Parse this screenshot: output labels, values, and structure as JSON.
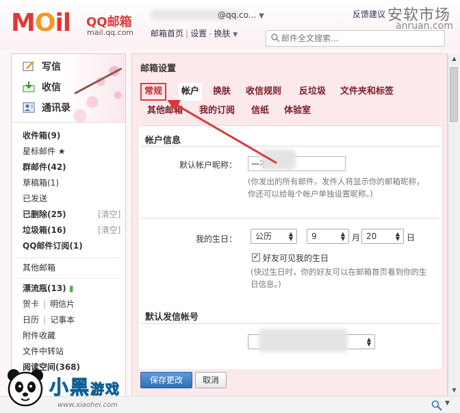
{
  "header": {
    "logo_text": "MOil",
    "logo_cn": "QQ邮箱",
    "logo_url": "mail.qq.com",
    "email_suffix": "@qq.co...",
    "nav": [
      "邮箱首页",
      "设置",
      "换肤"
    ],
    "feedback": "反馈建议",
    "watermark_cn": "安软市场",
    "watermark_url": "anruan.com",
    "search_placeholder": "邮件全文搜索..."
  },
  "sidebar": {
    "quick_actions": [
      {
        "label": "写信",
        "icon": "compose-icon"
      },
      {
        "label": "收信",
        "icon": "inbox-download-icon"
      },
      {
        "label": "通讯录",
        "icon": "contacts-icon"
      }
    ],
    "folders": [
      {
        "label": "收件箱(9)",
        "bold": true
      },
      {
        "label": "星标邮件 ★",
        "bold": false
      },
      {
        "label": "群邮件(42)",
        "bold": true
      },
      {
        "label": "草稿箱(1)",
        "bold": false
      },
      {
        "label": "已发送",
        "bold": false
      },
      {
        "label": "已删除(25)",
        "bold": true,
        "clear": "[清空]"
      },
      {
        "label": "垃圾箱(16)",
        "bold": true,
        "clear": "[清空]"
      },
      {
        "label": "QQ邮件订阅(1)",
        "bold": true
      }
    ],
    "other_mailbox": "其他邮箱",
    "extras": {
      "drift_bottle": "漂流瓶(13)",
      "greeting_card": "贺卡",
      "postcard": "明信片",
      "calendar": "日历",
      "notepad": "记事本",
      "attachments": "附件收藏",
      "file_transfer": "文件中转站",
      "reading_space": "阅读空间(368)"
    }
  },
  "main": {
    "title": "邮箱设置",
    "tabs": [
      "常规",
      "帐户",
      "换肤",
      "收信规则",
      "反垃圾",
      "文件夹和标签",
      "其他邮箱",
      "我的订阅",
      "信纸",
      "体验室"
    ],
    "account_section": {
      "title": "帐户信息",
      "nickname_label": "默认帐户昵称：",
      "nickname_value": "一不",
      "nickname_hint_1": "(你发出的所有邮件，发件人将显示你的邮箱昵称，",
      "nickname_hint_2": "你还可以给每个帐户单独设置昵称。)"
    },
    "birthday": {
      "label": "我的生日：",
      "calendar": "公历",
      "month": "9",
      "month_unit": "月",
      "day": "20",
      "day_unit": "日",
      "checkbox_label": "好友可见我的生日",
      "checked": true,
      "hint_1": "(快过生日时，你的好友可以在邮箱首页看到你的生",
      "hint_2": "日信息。)"
    },
    "sender_section": {
      "title": "默认发信帐号"
    },
    "buttons": {
      "save": "保存更改",
      "cancel": "取消"
    }
  },
  "brand": {
    "text": "小黑",
    "game": "游戏",
    "url": "www.xiaohei.com"
  },
  "colors": {
    "brand_red": "#e0383a",
    "tab_red": "#7a1e2a",
    "highlight_red": "#e03a3a",
    "panel_pink": "#fbe9ec",
    "primary_blue": "#2f6fb4"
  }
}
